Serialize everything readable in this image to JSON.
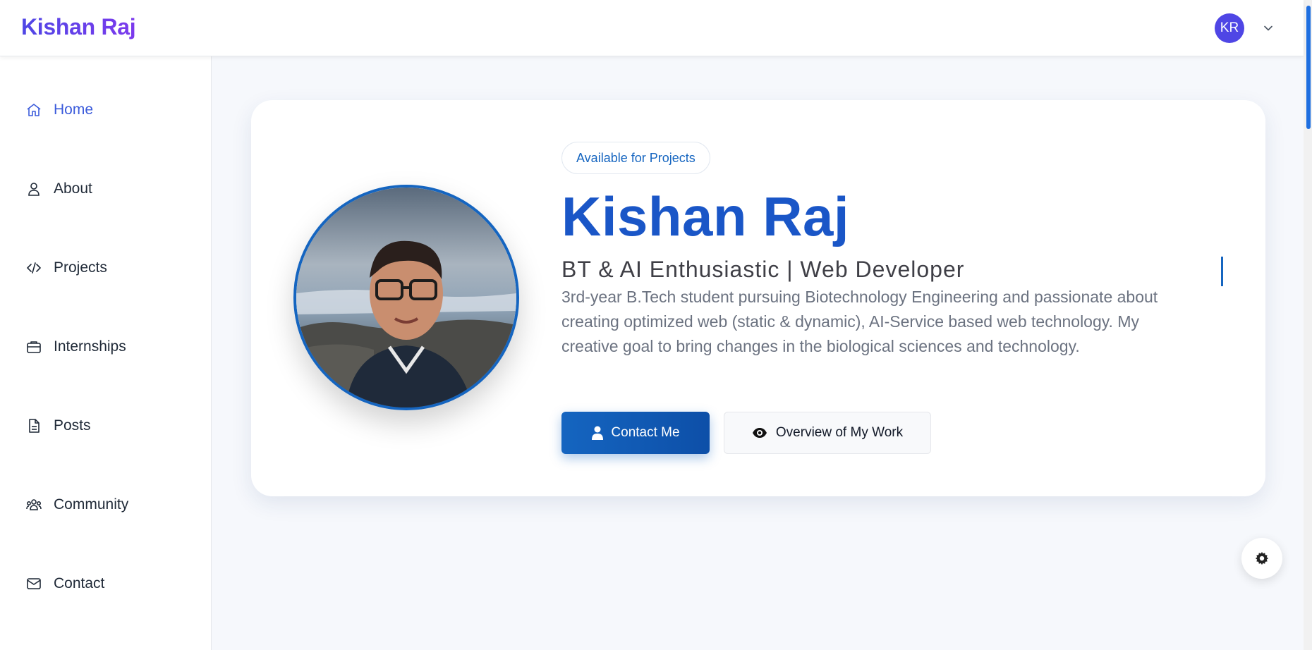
{
  "header": {
    "brand": "Kishan Raj",
    "avatar_initials": "KR",
    "menu_icon": "chevron-down-icon"
  },
  "sidebar": {
    "items": [
      {
        "label": "Home",
        "icon": "home-icon",
        "active": true
      },
      {
        "label": "About",
        "icon": "user-icon",
        "active": false
      },
      {
        "label": "Projects",
        "icon": "code-icon",
        "active": false
      },
      {
        "label": "Internships",
        "icon": "briefcase-icon",
        "active": false
      },
      {
        "label": "Posts",
        "icon": "document-icon",
        "active": false
      },
      {
        "label": "Community",
        "icon": "users-icon",
        "active": false
      },
      {
        "label": "Contact",
        "icon": "mail-icon",
        "active": false
      }
    ]
  },
  "hero": {
    "badge": "Available for Projects",
    "name": "Kishan Raj",
    "role": "BT & AI Enthusiastic | Web Developer",
    "description": "3rd-year B.Tech student pursuing Biotechnology Engineering and passionate about creating optimized web (static & dynamic), AI-Service based web technology. My creative goal to bring changes in the biological sciences and technology.",
    "primary_button": "Contact Me",
    "secondary_button": "Overview of My Work"
  },
  "colors": {
    "accent": "#1565c0",
    "brand_gradient_start": "#4f46e5",
    "brand_gradient_end": "#7c3aed",
    "active_nav": "#3b5bdb"
  }
}
